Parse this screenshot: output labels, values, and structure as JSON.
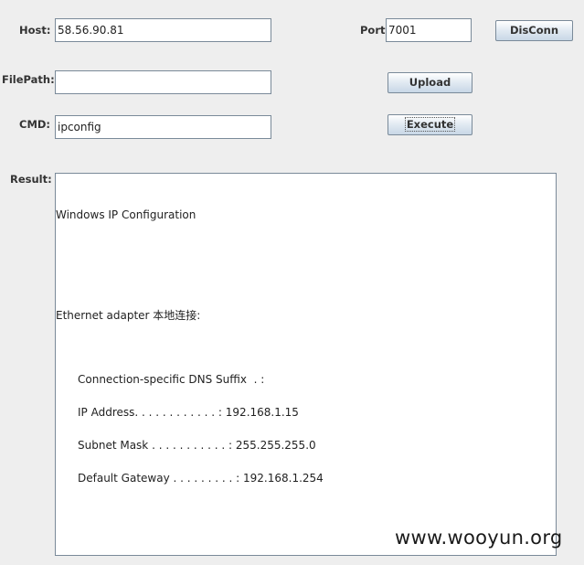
{
  "form": {
    "host_label": "Host:",
    "host_value": "58.56.90.81",
    "port_label": "Port:",
    "port_value": "7001",
    "filepath_label": "FilePath:",
    "filepath_value": "",
    "cmd_label": "CMD:",
    "cmd_value": "ipconfig",
    "result_label": "Result:"
  },
  "buttons": {
    "disconnect": "DisConn",
    "upload": "Upload",
    "execute": "Execute"
  },
  "result_lines": [
    "Windows IP Configuration",
    "Ethernet adapter 本地连接:",
    "Connection-specific DNS Suffix  . :",
    "IP Address. . . . . . . . . . . . : 192.168.1.15",
    "Subnet Mask . . . . . . . . . . . : 255.255.255.0",
    "Default Gateway . . . . . . . . . : 192.168.1.254"
  ],
  "watermark": "www.wooyun.org"
}
